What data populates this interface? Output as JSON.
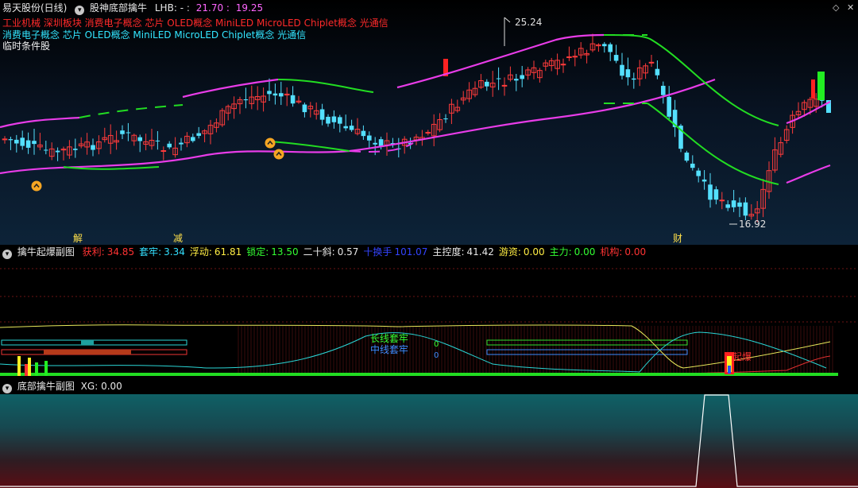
{
  "header": {
    "stock": "易天股份(日线)",
    "indicator": "股神底部擒牛",
    "lhb_label": "LHB:",
    "lhb_dash": "-",
    "value1": "21.70",
    "value2": "19.25",
    "colors": {
      "v1": "#ff66ff",
      "v2": "#ff66ff"
    }
  },
  "concepts_red": "工业机械 深圳板块 消费电子概念 芯片 OLED概念 MiniLED MicroLED Chiplet概念 光通信",
  "concepts_cyan": "消费电子概念 芯片 OLED概念 MiniLED MicroLED Chiplet概念 光通信",
  "temp_label": "临时条件股",
  "high_label": "25.24",
  "low_label": "16.92",
  "markers": {
    "jie": "解",
    "jian": "减",
    "cai": "财"
  },
  "sub1": {
    "title": "擒牛起爆副图",
    "stats": [
      {
        "label": "获利:",
        "value": "34.85",
        "lc": "#ff3333",
        "vc": "#ff3333"
      },
      {
        "label": "套牢:",
        "value": "3.34",
        "lc": "#33e0ff",
        "vc": "#33e0ff"
      },
      {
        "label": "浮动:",
        "value": "61.81",
        "lc": "#ffee44",
        "vc": "#ffee44"
      },
      {
        "label": "锁定:",
        "value": "13.50",
        "lc": "#33ff33",
        "vc": "#33ff33"
      },
      {
        "label": "二十斜:",
        "value": "0.57",
        "lc": "#e8e8e8",
        "vc": "#e8e8e8"
      },
      {
        "label": "十换手",
        "value": "101.07",
        "lc": "#3344ff",
        "vc": "#3344ff"
      },
      {
        "label": "主控度:",
        "value": "41.42",
        "lc": "#e8e8e8",
        "vc": "#e8e8e8"
      },
      {
        "label": "游资:",
        "value": "0.00",
        "lc": "#ffee44",
        "vc": "#ffee44"
      },
      {
        "label": "主力:",
        "value": "0.00",
        "lc": "#33ff33",
        "vc": "#33ff33"
      },
      {
        "label": "机构:",
        "value": "0.00",
        "lc": "#ff3333",
        "vc": "#ff3333"
      }
    ],
    "long_label": "长线套牢",
    "mid_label": "中线套牢",
    "zero1": "0",
    "zero2": "0",
    "boom_label": "起爆"
  },
  "sub2": {
    "title": "底部擒牛副图",
    "xg_label": "XG:",
    "xg_value": "0.00"
  }
}
